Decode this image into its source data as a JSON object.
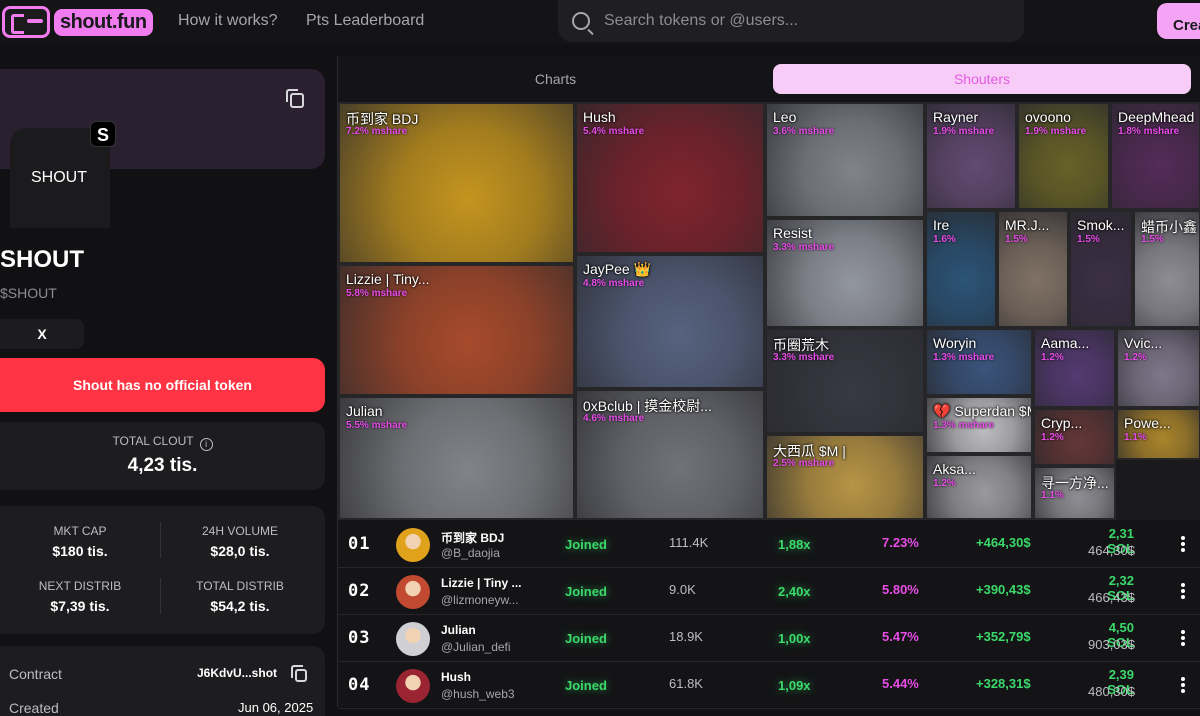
{
  "header": {
    "logo_text": "shout.fun",
    "nav": [
      "How it works?",
      "Pts Leaderboard"
    ],
    "search_placeholder": "Search tokens or @users...",
    "create_label": "Crea"
  },
  "token": {
    "avatar_label": "SHOUT",
    "badge_letter": "S",
    "name": "SHOUT",
    "symbol": "$SHOUT",
    "x_label": "X",
    "warning": "Shout has no official token",
    "clout_label": "TOTAL CLOUT",
    "clout_value": "4,23 tis.",
    "stats": [
      {
        "label": "MKT CAP",
        "value": "$180 tis."
      },
      {
        "label": "24H VOLUME",
        "value": "$28,0 tis."
      },
      {
        "label": "NEXT DISTRIB",
        "value": "$7,39 tis."
      },
      {
        "label": "TOTAL DISTRIB",
        "value": "$54,2 tis."
      }
    ],
    "contract_label": "Contract",
    "contract_value": "J6KdvU...shot",
    "created_label": "Created",
    "created_value": "Jun 06, 2025"
  },
  "tabs": {
    "charts": "Charts",
    "shouters": "Shouters"
  },
  "treemap": [
    {
      "name": "币到家 BDJ",
      "share": "7.2% mshare",
      "color": "#d7a21f"
    },
    {
      "name": "Hush",
      "share": "5.4% mshare",
      "color": "#8a2530"
    },
    {
      "name": "Leo",
      "share": "3.6% mshare",
      "color": "#8b8f96"
    },
    {
      "name": "Rayner",
      "share": "1.9% mshare",
      "color": "#6a4f7a"
    },
    {
      "name": "ovoono",
      "share": "1.9% mshare",
      "color": "#6f6a2a"
    },
    {
      "name": "DeepMhead",
      "share": "1.8% mshare",
      "color": "#5a2e5e"
    },
    {
      "name": "Resist",
      "share": "3.3% mshare",
      "color": "#a0a4ad"
    },
    {
      "name": "Ire",
      "share": "1.6%",
      "color": "#2e5a80"
    },
    {
      "name": "MR.J...",
      "share": "1.5%",
      "color": "#8b7b6d"
    },
    {
      "name": "Smok...",
      "share": "1.5%",
      "color": "#40324a"
    },
    {
      "name": "蜡币小鑫",
      "share": "1.5%",
      "color": "#9b9aa3"
    },
    {
      "name": "Lizzie | Tiny...",
      "share": "5.8% mshare",
      "color": "#b7502e"
    },
    {
      "name": "JayPee 👑",
      "share": "4.8% mshare",
      "color": "#5d6a8a"
    },
    {
      "name": "币圈荒木",
      "share": "3.3% mshare",
      "color": "#3b3c46"
    },
    {
      "name": "Woryin",
      "share": "1.3% mshare",
      "color": "#3e5a85"
    },
    {
      "name": "Aama...",
      "share": "1.2%",
      "color": "#5a3e7a"
    },
    {
      "name": "Vvic...",
      "share": "1.2%",
      "color": "#8a8297"
    },
    {
      "name": "Julian",
      "share": "5.5% mshare",
      "color": "#8d8f94"
    },
    {
      "name": "0xBclub | 摸金校尉...",
      "share": "4.6% mshare",
      "color": "#7a7c82"
    },
    {
      "name": "大西瓜 $M |",
      "share": "2.5% mshare",
      "color": "#c9a24a"
    },
    {
      "name": "💔 Superdan $M...",
      "share": "1.3% mshare",
      "color": "#cfcfd3"
    },
    {
      "name": "Cryp...",
      "share": "1.2%",
      "color": "#6b3a3a"
    },
    {
      "name": "Powe...",
      "share": "1.1%",
      "color": "#b9902d"
    },
    {
      "name": "Aksa...",
      "share": "1.2%",
      "color": "#a8a8ac"
    },
    {
      "name": "寻一方净...",
      "share": "1.1%",
      "color": "#9a9aa0"
    }
  ],
  "rows": [
    {
      "rank": "01",
      "name": "币到家 BDJ",
      "handle": "@B_daojia",
      "status": "Joined",
      "followers": "111.4K",
      "mult": "1,88x",
      "share": "7.23%",
      "pnl": "+464,30$",
      "sol": "2,31 SOL",
      "usd": "464,30$",
      "avatar_color": "#e0a21b"
    },
    {
      "rank": "02",
      "name": "Lizzie | Tiny ...",
      "handle": "@lizmoneyw...",
      "status": "Joined",
      "followers": "9.0K",
      "mult": "2,40x",
      "share": "5.80%",
      "pnl": "+390,43$",
      "sol": "2,32 SOL",
      "usd": "466,43$",
      "avatar_color": "#c14a31"
    },
    {
      "rank": "03",
      "name": "Julian",
      "handle": "@Julian_defi",
      "status": "Joined",
      "followers": "18.9K",
      "mult": "1,00x",
      "share": "5.47%",
      "pnl": "+352,79$",
      "sol": "4,50 SOL",
      "usd": "903,03$",
      "avatar_color": "#cfcfd4"
    },
    {
      "rank": "04",
      "name": "Hush",
      "handle": "@hush_web3",
      "status": "Joined",
      "followers": "61.8K",
      "mult": "1,09x",
      "share": "5.44%",
      "pnl": "+328,31$",
      "sol": "2,39 SOL",
      "usd": "480,30$",
      "avatar_color": "#9b2433"
    }
  ]
}
